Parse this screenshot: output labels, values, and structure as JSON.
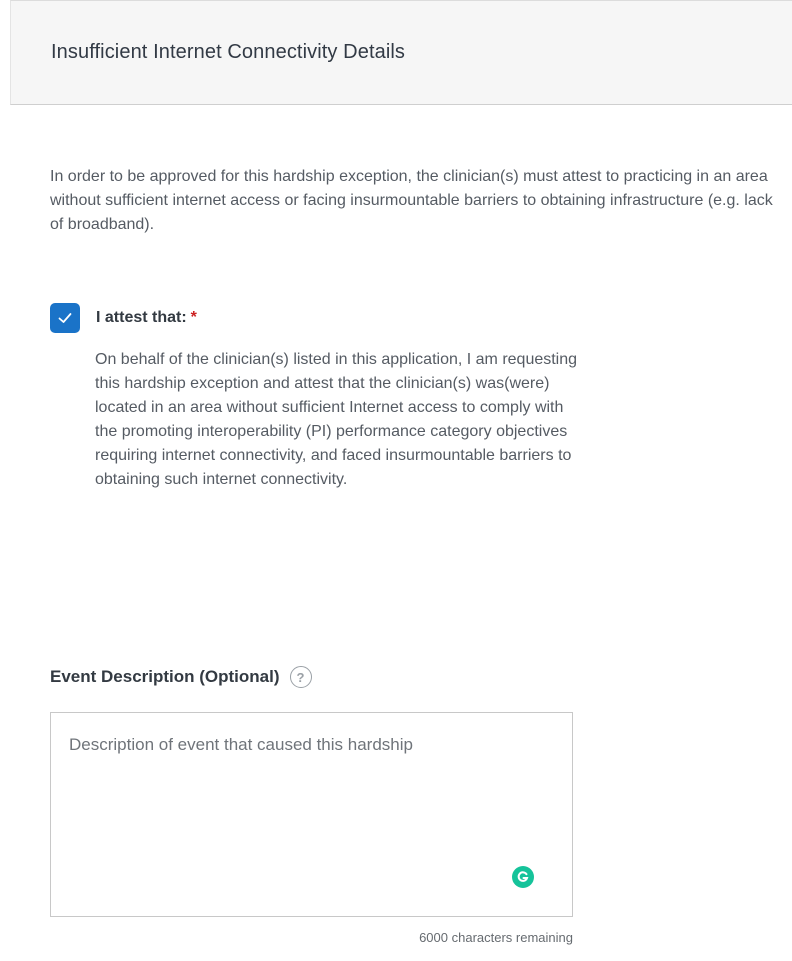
{
  "header": {
    "title": "Insufficient Internet Connectivity Details"
  },
  "intro": {
    "text": "In order to be approved for this hardship exception, the clinician(s) must attest to practicing in an area without sufficient internet access or facing insurmountable barriers to obtaining infrastructure (e.g. lack of broadband)."
  },
  "attestation": {
    "checked": true,
    "label": "I attest that:",
    "required_marker": "*",
    "text": "On behalf of the clinician(s) listed in this application, I am requesting this hardship exception and attest that the clinician(s) was(were) located in an area without sufficient Internet access to comply with the promoting interoperability (PI) performance category objectives requiring internet connectivity, and faced insurmountable barriers to obtaining such internet connectivity."
  },
  "event_description": {
    "label": "Event Description (Optional)",
    "help_icon": "question-circle-icon",
    "placeholder": "Description of event that caused this hardship",
    "value": "",
    "chars_remaining": "6000 characters remaining",
    "grammarly_icon": "grammarly-icon"
  },
  "colors": {
    "checkbox": "#1a73c8",
    "required": "#cc2222",
    "grammarly": "#15c39a"
  }
}
